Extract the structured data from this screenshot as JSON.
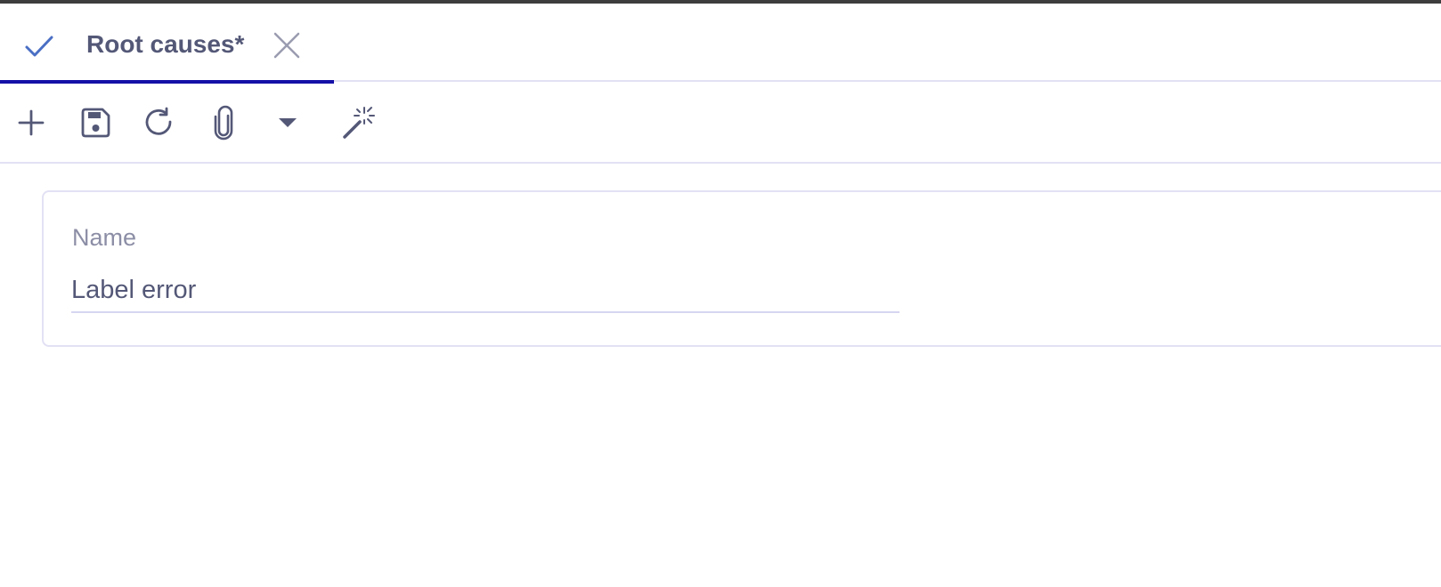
{
  "tab": {
    "title": "Root causes*",
    "status_icon": "check-icon",
    "close_icon": "close-icon"
  },
  "toolbar": {
    "tools": [
      "plus-icon",
      "save-icon",
      "refresh-icon",
      "paperclip-icon",
      "caret-down-icon",
      "magic-wand-icon"
    ]
  },
  "form": {
    "name_label": "Name",
    "name_value": "Label error"
  },
  "colors": {
    "accent": "#1511a7",
    "check": "#4a6fc4",
    "text": "#545877",
    "label": "#8c8ea6",
    "border": "#e2e1f4"
  }
}
